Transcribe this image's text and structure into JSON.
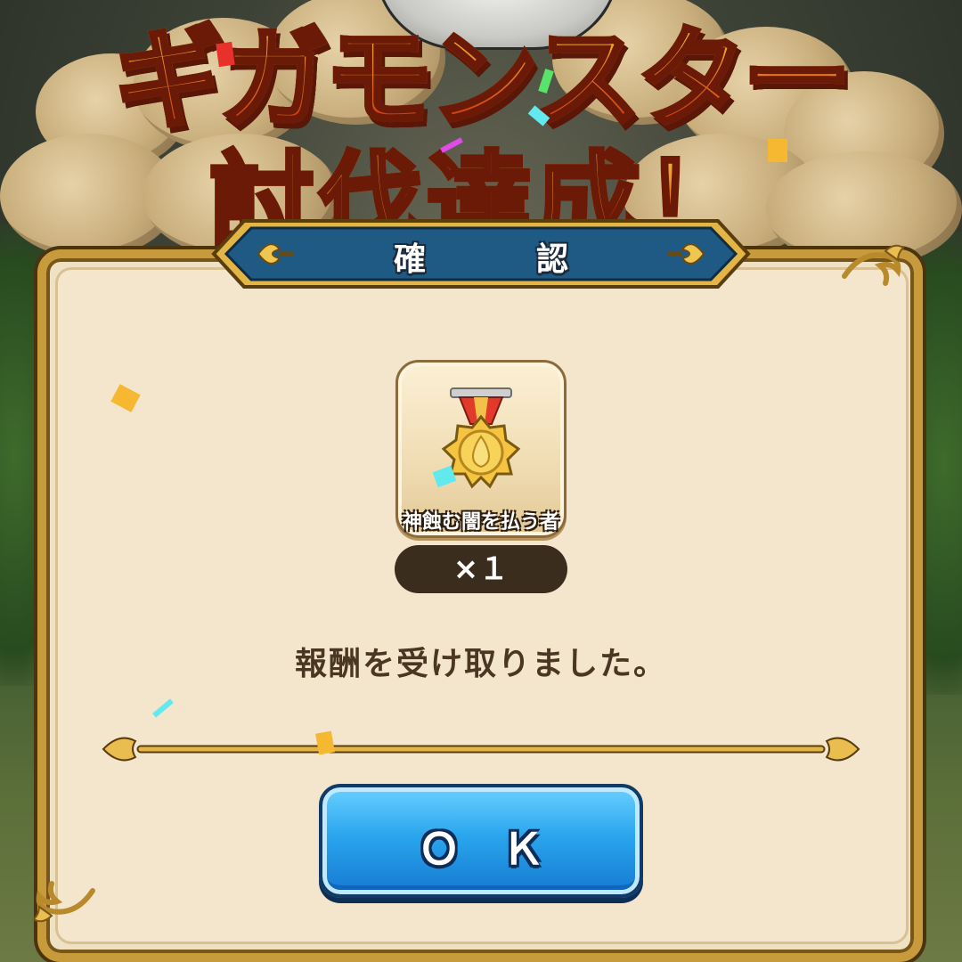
{
  "banner": {
    "line1": "ギガモンスター",
    "line2": "討伐達成！"
  },
  "dialog": {
    "title": "確　認",
    "reward": {
      "icon": "medal-icon",
      "name": "神蝕む闇を払う者",
      "count": "×１"
    },
    "message": "報酬を受け取りました。",
    "ok_label": "ＯＫ"
  },
  "colors": {
    "dialog_bg": "#f3e6cc",
    "gold_frame": "#c79a3b",
    "header_blue": "#1f5a85",
    "button_blue": "#2aa6ee",
    "text_brown": "#4a3622",
    "pill_dark": "#3b2d1e"
  }
}
